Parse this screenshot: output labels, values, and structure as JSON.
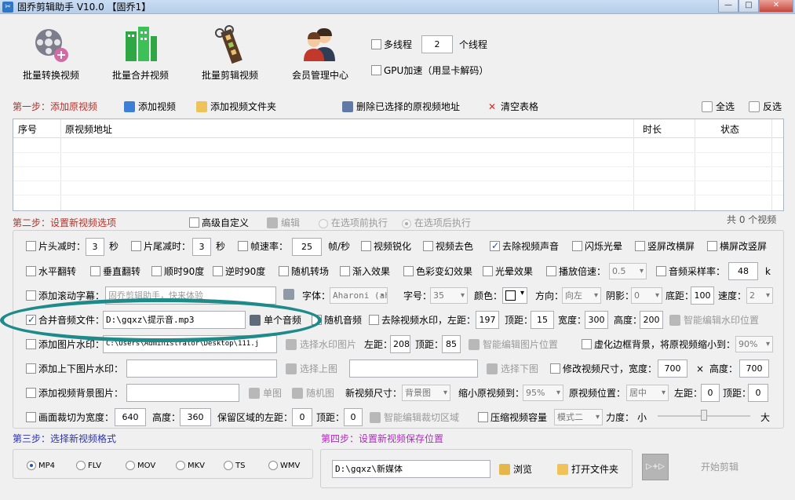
{
  "window": {
    "title": "固乔剪辑助手 V10.0 【固乔1】",
    "min_label": "—",
    "max_label": "□",
    "close_label": "✕"
  },
  "toolbar": {
    "buttons": [
      {
        "label": "批量转换视频",
        "icon": "film-reel-icon"
      },
      {
        "label": "批量合并视频",
        "icon": "building-blocks-icon"
      },
      {
        "label": "批量剪辑视频",
        "icon": "scissors-film-icon"
      },
      {
        "label": "会员管理中心",
        "icon": "users-icon"
      }
    ],
    "multithread_label": "多线程",
    "multithread_value": "2",
    "thread_unit": "个线程",
    "gpu_label": "GPU加速（用显卡解码）"
  },
  "step1": {
    "title": "第一步：添加原视频",
    "add_video": "添加视频",
    "add_folder": "添加视频文件夹",
    "delete_selected": "删除已选择的原视频地址",
    "clear_table": "清空表格",
    "select_all": "全选",
    "invert": "反选",
    "columns": [
      "序号",
      "原视频地址",
      "时长",
      "状态"
    ]
  },
  "step2": {
    "title": "第二步：设置新视频选项",
    "advanced_custom": "高级自定义",
    "edit": "编辑",
    "before_option": "在选项前执行",
    "after_option": "在选项后执行",
    "video_count": "共 0 个视频",
    "head_cut": "片头减时：",
    "head_cut_value": "3",
    "sec1": "秒",
    "tail_cut": "片尾减时：",
    "tail_cut_value": "3",
    "sec2": "秒",
    "framerate": "帧速率：",
    "framerate_value": "25",
    "fps_unit": "帧/秒",
    "sharpen": "视频锐化",
    "decolor": "视频去色",
    "remove_audio": "去除视频声音",
    "flash": "闪烁光晕",
    "v2h": "竖屏改横屏",
    "h2v": "横屏改竖屏",
    "hflip": "水平翻转",
    "vflip": "垂直翻转",
    "cw90": "顺时90度",
    "ccw90": "逆时90度",
    "random_transition": "随机转场",
    "fade_in": "渐入效果",
    "color_change": "色彩变幻效果",
    "glow": "光晕效果",
    "speed": "播放倍速：",
    "speed_value": "0.5",
    "sample_rate": "音频采样率：",
    "sample_rate_value": "48",
    "k_unit": "k",
    "scroll_sub": "添加滚动字幕：",
    "scroll_sub_value": "固乔剪辑助手，快来体验",
    "font": "字体：",
    "font_value": "Aharoni (ahr",
    "font_size": "字号：",
    "font_size_value": "35",
    "color": "颜色：",
    "direction": "方向：",
    "direction_value": "向左",
    "shadow": "阴影：",
    "shadow_value": "0",
    "bottom_margin": "底距：",
    "bottom_margin_value": "100",
    "speed2": "速度：",
    "speed2_value": "2",
    "merge_audio": "合并音频文件：",
    "merge_audio_value": "D:\\gqxz\\提示音.mp3",
    "single_audio": "单个音频",
    "random_audio": "随机音频",
    "remove_watermark": "去除视频水印，左距：",
    "wm_left": "197",
    "top_label": "顶距：",
    "wm_top": "15",
    "width_label": "宽度：",
    "wm_width": "300",
    "height_label": "高度：",
    "wm_height": "200",
    "smart_wm_pos": "智能编辑水印位置",
    "add_image_wm": "添加图片水印：",
    "image_wm_value": "C:\\Users\\Administrator\\Desktop\\111.j",
    "choose_wm_image": "选择水印图片",
    "left_label": "左距：",
    "img_left": "208",
    "img_top_label": "顶距：",
    "img_top": "85",
    "smart_img_pos": "智能编辑图片位置",
    "blur_bg": "虚化边框背景，将原视频缩小到：",
    "blur_scale": "90%",
    "add_topbottom_wm": "添加上下图片水印：",
    "choose_top": "选择上图",
    "choose_bottom": "选择下图",
    "resize": "修改视频尺寸，宽度：",
    "resize_w": "700",
    "times": "×",
    "resize_h_label": "高度：",
    "resize_h": "700",
    "add_bg_image": "添加视频背景图片：",
    "single_img": "单图",
    "random_img": "随机图",
    "new_size": "新视频尺寸：",
    "new_size_value": "背景图",
    "shrink_to": "缩小原视频到：",
    "shrink_value": "95%",
    "orig_pos": "原视频位置：",
    "orig_pos_value": "居中",
    "pos_left_label": "左距：",
    "pos_left": "0",
    "pos_top_label": "顶距：",
    "pos_top": "0",
    "crop": "画面裁切为宽度：",
    "crop_w": "640",
    "crop_h_label": "高度：",
    "crop_h": "360",
    "keep_left": "保留区域的左距：",
    "keep_left_value": "0",
    "keep_top_label": "顶距：",
    "keep_top_value": "0",
    "smart_crop": "智能编辑裁切区域",
    "compress": "压缩视频容量",
    "compress_mode": "模式二",
    "strength": "力度：",
    "small": "小",
    "large": "大",
    "strength_level": 0.5
  },
  "step3": {
    "title": "第三步：选择新视频格式",
    "formats": [
      "MP4",
      "FLV",
      "MOV",
      "MKV",
      "TS",
      "WMV"
    ],
    "selected": "MP4"
  },
  "step4": {
    "title": "第四步：设置新视频保存位置",
    "save_path": "D:\\gqxz\\新媒体",
    "browse": "浏览",
    "open_folder": "打开文件夹",
    "start": "开始剪辑",
    "start_icon_text": "▷+▷"
  }
}
